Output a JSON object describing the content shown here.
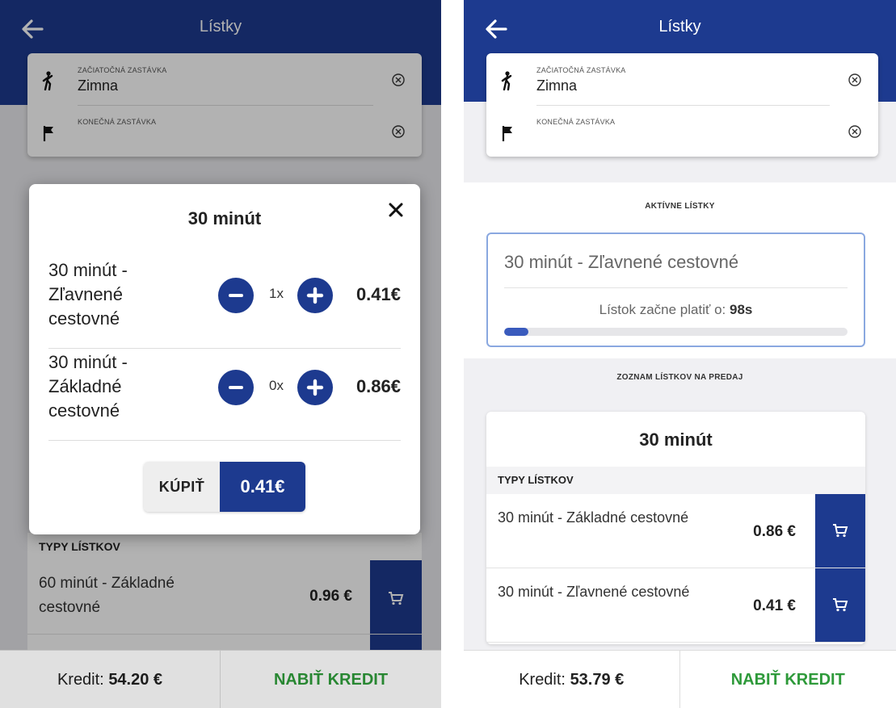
{
  "colors": {
    "primary": "#1d3a8f",
    "accent_green": "#2e9a3a"
  },
  "left": {
    "appbar": {
      "title": "Lístky",
      "back_icon": "arrow-left-icon"
    },
    "stops": {
      "start_label": "ZAČIATOČNÁ ZASTÁVKA",
      "start_value": "Zimna",
      "end_label": "KONEČNÁ ZASTÁVKA",
      "end_value": ""
    },
    "modal": {
      "title": "30 minút",
      "close_icon": "close-icon",
      "items": [
        {
          "name": "30 minút - Zľavnené cestovné",
          "qty": "1x",
          "price": "0.41€"
        },
        {
          "name": "30 minút - Základné cestovné",
          "qty": "0x",
          "price": "0.86€"
        }
      ],
      "buy_label": "KÚPIŤ",
      "buy_price": "0.41€"
    },
    "list": {
      "types_header": "TYPY LÍSTKOV",
      "items": [
        {
          "name": "60 minút - Základné cestovné",
          "price": "0.96 €"
        }
      ]
    },
    "bottom": {
      "kredit_label": "Kredit:",
      "kredit_value": "54.20 €",
      "nabit": "NABIŤ KREDIT"
    }
  },
  "right": {
    "appbar": {
      "title": "Lístky",
      "back_icon": "arrow-left-icon"
    },
    "stops": {
      "start_label": "ZAČIATOČNÁ ZASTÁVKA",
      "start_value": "Zimna",
      "end_label": "KONEČNÁ ZASTÁVKA",
      "end_value": ""
    },
    "active_title": "AKTÍVNE LÍSTKY",
    "active": {
      "name": "30 minút - Zľavnené cestovné",
      "status_label": "Lístok začne platiť o:",
      "status_value": "98s",
      "progress": 0.07
    },
    "sale_title": "ZOZNAM LÍSTKOV NA PREDAJ",
    "sale": {
      "title": "30 minút",
      "types_header": "TYPY LÍSTKOV",
      "items": [
        {
          "name": "30 minút - Základné cestovné",
          "price": "0.86 €"
        },
        {
          "name": "30 minút - Zľavnené cestovné",
          "price": "0.41 €"
        }
      ]
    },
    "bottom": {
      "kredit_label": "Kredit:",
      "kredit_value": "53.79 €",
      "nabit": "NABIŤ KREDIT"
    }
  }
}
